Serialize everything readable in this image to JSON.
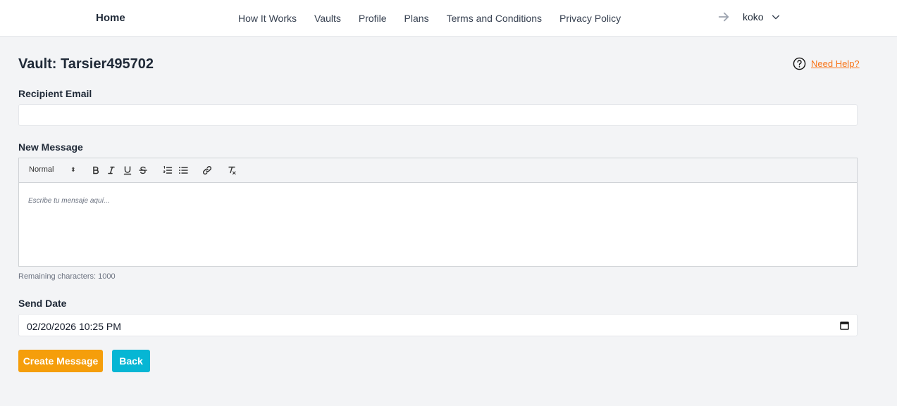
{
  "nav": {
    "brand": "Home",
    "links": [
      "How It Works",
      "Vaults",
      "Profile",
      "Plans",
      "Terms and Conditions",
      "Privacy Policy"
    ],
    "user": "koko"
  },
  "page": {
    "title": "Vault: Tarsier495702",
    "help_link": "Need Help?"
  },
  "form": {
    "recipient_label": "Recipient Email",
    "recipient_value": "",
    "message_label": "New Message",
    "toolbar_heading": "Normal",
    "editor_placeholder": "Escribe tu mensaje aquí...",
    "remaining": "Remaining characters: 1000",
    "send_date_label": "Send Date",
    "send_date_value": "02/20/2026 10:25 PM"
  },
  "buttons": {
    "create": "Create Message",
    "back": "Back"
  },
  "colors": {
    "accent_orange": "#f59e0b",
    "accent_cyan": "#06b6d4",
    "link_orange": "#f97316"
  }
}
